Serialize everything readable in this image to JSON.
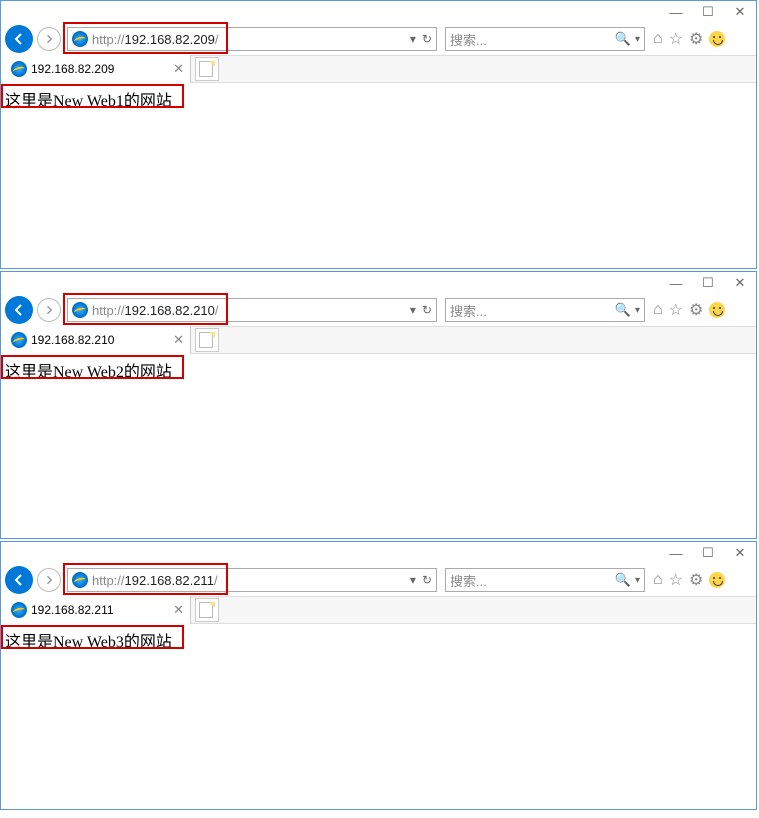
{
  "windows": [
    {
      "url_scheme": "http://",
      "url_host": "192.168.82.209",
      "url_trail": "/",
      "tab_title": "192.168.82.209",
      "body_text": "这里是New Web1的网站",
      "highlight_width": 183
    },
    {
      "url_scheme": "http://",
      "url_host": "192.168.82.210",
      "url_trail": "/",
      "tab_title": "192.168.82.210",
      "body_text": "这里是New Web2的网站",
      "highlight_width": 183
    },
    {
      "url_scheme": "http://",
      "url_host": "192.168.82.211",
      "url_trail": "/",
      "tab_title": "192.168.82.211",
      "body_text": "这里是New Web3的网站",
      "highlight_width": 183
    }
  ],
  "search_placeholder": "搜索...",
  "window_controls": {
    "min": "—",
    "max": "☐",
    "close": "✕"
  }
}
